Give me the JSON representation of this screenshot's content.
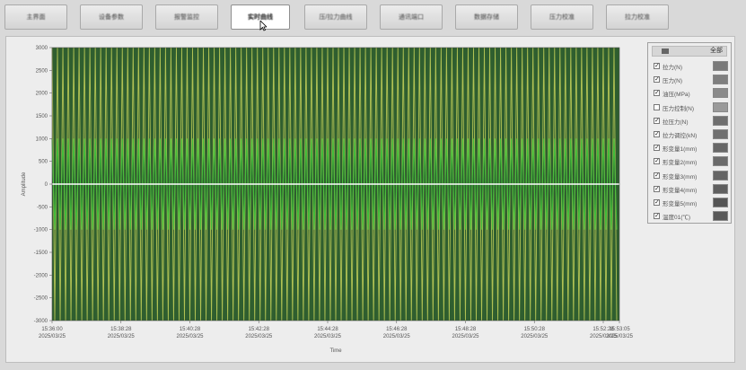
{
  "tabs": [
    {
      "label": "主界面",
      "active": false
    },
    {
      "label": "设备参数",
      "active": false
    },
    {
      "label": "报警监控",
      "active": false
    },
    {
      "label": "实时曲线",
      "active": true
    },
    {
      "label": "压/拉力曲线",
      "active": false
    },
    {
      "label": "通讯端口",
      "active": false
    },
    {
      "label": "数据存储",
      "active": false
    },
    {
      "label": "压力校准",
      "active": false
    },
    {
      "label": "拉力校准",
      "active": false
    }
  ],
  "legend": {
    "header": "全部",
    "items": [
      {
        "label": "拉力(N)",
        "checked": true,
        "color": "#7a7a7a"
      },
      {
        "label": "压力(N)",
        "checked": true,
        "color": "#7f7f7f"
      },
      {
        "label": "油压(MPa)",
        "checked": true,
        "color": "#8a8a8a"
      },
      {
        "label": "压力控制(N)",
        "checked": false,
        "color": "#9a9a9a"
      },
      {
        "label": "拉压力(N)",
        "checked": true,
        "color": "#6f6f6f"
      },
      {
        "label": "拉力调控(kN)",
        "checked": true,
        "color": "#707070"
      },
      {
        "label": "形变量1(mm)",
        "checked": true,
        "color": "#666666"
      },
      {
        "label": "形变量2(mm)",
        "checked": true,
        "color": "#6a6a6a"
      },
      {
        "label": "形变量3(mm)",
        "checked": true,
        "color": "#646464"
      },
      {
        "label": "形变量4(mm)",
        "checked": true,
        "color": "#5f5f5f"
      },
      {
        "label": "形变量5(mm)",
        "checked": true,
        "color": "#555555"
      },
      {
        "label": "温度01(℃)",
        "checked": true,
        "color": "#585858"
      }
    ]
  },
  "chart_data": {
    "type": "line",
    "xlabel": "Time",
    "ylabel": "Amplitude",
    "ylim": [
      -3000,
      3000
    ],
    "yticks": [
      3000,
      2500,
      2000,
      1500,
      1000,
      500,
      0,
      -500,
      -1000,
      -1500,
      -2000,
      -2500,
      -3000
    ],
    "xticks": [
      {
        "time": "15:36:00",
        "date": "2025/03/25"
      },
      {
        "time": "15:38:28",
        "date": "2025/03/25"
      },
      {
        "time": "15:40:28",
        "date": "2025/03/25"
      },
      {
        "time": "15:42:28",
        "date": "2025/03/25"
      },
      {
        "time": "15:44:28",
        "date": "2025/03/25"
      },
      {
        "time": "15:46:28",
        "date": "2025/03/25"
      },
      {
        "time": "15:48:28",
        "date": "2025/03/25"
      },
      {
        "time": "15:50:28",
        "date": "2025/03/25"
      },
      {
        "time": "15:52:28",
        "date": "2025/03/25"
      },
      {
        "time": "15:53:05",
        "date": "2025/03/25"
      }
    ],
    "series": [
      {
        "values_range": [
          -3000,
          3000
        ],
        "color": "#c8d45a",
        "cycles": 105
      },
      {
        "values_range": [
          -1000,
          1000
        ],
        "color": "#3fbf3a",
        "cycles": 105
      },
      {
        "values_range": [
          0,
          0
        ],
        "color": "#ffffff"
      }
    ],
    "grid": false
  },
  "colors": {
    "plot_bg": "#2f5e2f",
    "yellow_series": "#c8d45a",
    "green_series": "#3fbf3a",
    "zero_line": "#ffffff"
  }
}
